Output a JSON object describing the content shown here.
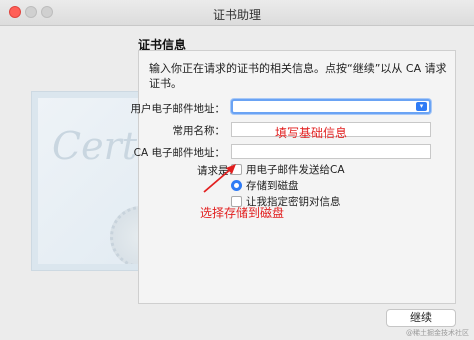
{
  "window": {
    "title": "证书助理"
  },
  "section": {
    "title": "证书信息",
    "intro": "输入你正在请求的证书的相关信息。点按“继续”以从 CA 请求证书。"
  },
  "form": {
    "email_label": "用户电子邮件地址：",
    "email_value": "",
    "name_label": "常用名称：",
    "name_value": "",
    "ca_email_label": "CA 电子邮件地址：",
    "ca_email_value": "",
    "request_label": "请求是：",
    "options": {
      "email_to_ca": "用电子邮件发送给CA",
      "save_to_disk": "存储到磁盘",
      "specify_key": "让我指定密钥对信息"
    }
  },
  "annotations": {
    "fill_info": "填写基础信息",
    "choose_disk": "选择存储到磁盘"
  },
  "buttons": {
    "continue": "继续"
  },
  "watermark": "@稀土掘金技术社区",
  "colors": {
    "accent": "#2f7bf5",
    "annotation": "#e21f1f",
    "close": "#ff5f57"
  }
}
